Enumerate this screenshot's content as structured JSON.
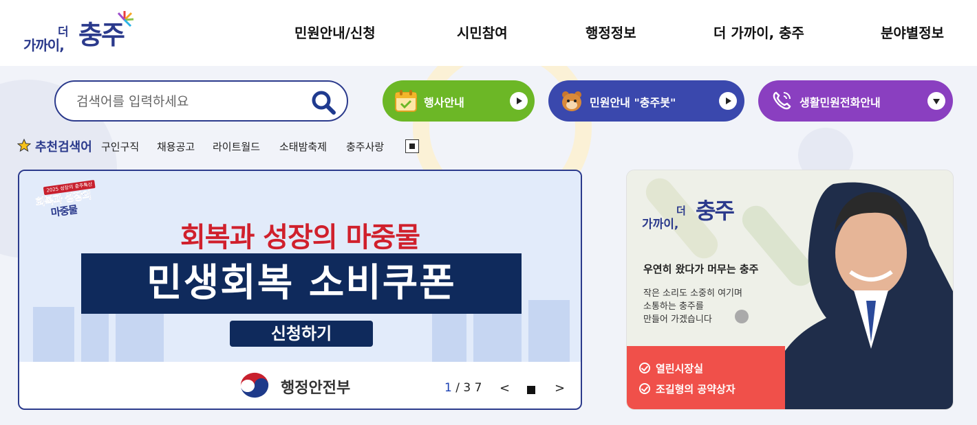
{
  "logo": {
    "small": "가까이,",
    "de": "더",
    "big": "충주"
  },
  "nav": [
    "민원안내/신청",
    "시민참여",
    "행정정보",
    "더 가까이, 충주",
    "분야별정보"
  ],
  "search": {
    "placeholder": "검색어를 입력하세요"
  },
  "quick": [
    {
      "label": "행사안내",
      "color": "#6cb726",
      "icon": "calendar-icon"
    },
    {
      "label": "민원안내 \"충주봇\"",
      "color": "#3a48ad",
      "icon": "bot-icon"
    },
    {
      "label": "생활민원전화안내",
      "color": "#8a3fc0",
      "icon": "phone-icon"
    }
  ],
  "recommended": {
    "title": "추천검색어",
    "keywords": [
      "구인구직",
      "채용공고",
      "라이트월드",
      "소태밤축제",
      "충주사랑"
    ]
  },
  "banner": {
    "badge_top": "2025 성장의 충주특산",
    "badge_line1": "회복과 성장의",
    "badge_line2": "마중물",
    "headline": "회복과 성장의 마중물",
    "title": "민생회복 소비쿠폰",
    "button": "신청하기",
    "ministry": "행정안전부",
    "page_current": "1",
    "page_total": "/ 3 7",
    "prev": "<",
    "next": ">"
  },
  "mayor": {
    "logo_small": "가까이,",
    "logo_de": "더",
    "logo_big": "충주",
    "slogan": "우연히 왔다가 머무는 충주",
    "desc": [
      "작은 소리도 소중히 여기며",
      "소통하는 충주를",
      "만들어 가겠습니다"
    ],
    "links": [
      "열린시장실",
      "조길형의 공약상자"
    ]
  },
  "colors": {
    "brand": "#2b3a8c",
    "banner_navy": "#0f2a5c",
    "red": "#d0202c",
    "card_red": "#f0504a"
  }
}
